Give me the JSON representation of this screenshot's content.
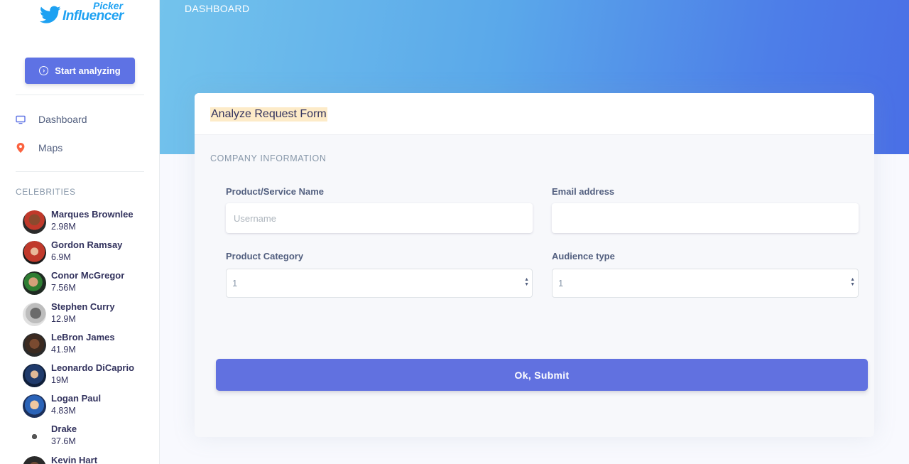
{
  "brand": {
    "logo_top": "Picker",
    "logo_main": "Influencer",
    "color": "#1da1f2"
  },
  "sidebar": {
    "start_button": {
      "label": "Start analyzing",
      "icon": "arrow-circle-right-icon"
    },
    "nav": [
      {
        "label": "Dashboard",
        "icon": "monitor-icon",
        "color": "#5e72e4"
      },
      {
        "label": "Maps",
        "icon": "map-pin-icon",
        "color": "#fb6340"
      }
    ],
    "celebrities_heading": "CELEBRITIES",
    "celebrities": [
      {
        "name": "Marques Brownlee",
        "followers": "2.98M"
      },
      {
        "name": "Gordon Ramsay",
        "followers": "6.9M"
      },
      {
        "name": "Conor McGregor",
        "followers": "7.56M"
      },
      {
        "name": "Stephen Curry",
        "followers": "12.9M"
      },
      {
        "name": "LeBron James",
        "followers": "41.9M"
      },
      {
        "name": "Leonardo DiCaprio",
        "followers": "19M"
      },
      {
        "name": "Logan Paul",
        "followers": "4.83M"
      },
      {
        "name": "Drake",
        "followers": "37.6M"
      },
      {
        "name": "Kevin Hart",
        "followers": ""
      }
    ]
  },
  "header": {
    "breadcrumb": "DASHBOARD"
  },
  "form": {
    "title": "Analyze Request Form",
    "section": "COMPANY INFORMATION",
    "product_name": {
      "label": "Product/Service Name",
      "placeholder": "Username",
      "value": ""
    },
    "email": {
      "label": "Email address",
      "placeholder": "",
      "value": ""
    },
    "category": {
      "label": "Product Category",
      "selected": "1"
    },
    "audience": {
      "label": "Audience type",
      "selected": "1"
    },
    "submit_label": "Ok, Submit"
  },
  "colors": {
    "primary": "#5e72e4",
    "header_gradient_start": "#73c3ec",
    "header_gradient_end": "#4a6fe6"
  }
}
